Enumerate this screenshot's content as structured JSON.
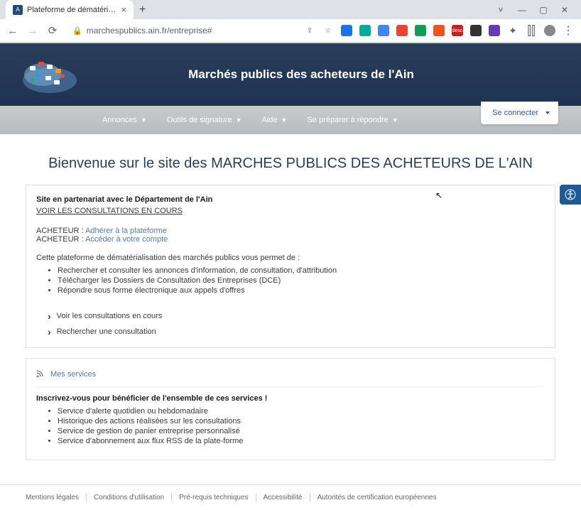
{
  "browser": {
    "tab_title": "Plateforme de dématérialisation",
    "url": "marchespublics.ain.fr/entreprise#"
  },
  "site": {
    "title": "Marchés publics des acheteurs de l'Ain"
  },
  "nav": {
    "items": [
      {
        "label": "Annonces"
      },
      {
        "label": "Outils de signature"
      },
      {
        "label": "Aide"
      },
      {
        "label": "Se préparer à répondre"
      }
    ],
    "login": "Se connecter"
  },
  "main": {
    "title": "Bienvenue sur le site des MARCHES PUBLICS DES ACHETEURS DE L'AIN",
    "panel1": {
      "partner": "Site en partenariat avec le Département de l'Ain",
      "consult_link": "VOIR LES CONSULTATIONS EN COURS",
      "buyer_label": "ACHETEUR : ",
      "buyer_join": "Adhérer à la plateforme",
      "buyer_access": "Accéder à votre compte",
      "intro": "Cette plateforme de dématérialisation des marchés publics vous permet de :",
      "bullets": [
        "Rechercher et consulter les annonces d'information, de consultation, d'attribution",
        "Télécharger les Dossiers de Consultation des Entreprises (DCE)",
        "Répondre sous forme électronique aux appels d'offres"
      ],
      "arrows": [
        "Voir les consultations en cours",
        "Rechercher une consultation"
      ]
    },
    "panel2": {
      "header": "Mes services",
      "intro": "Inscrivez-vous pour bénéficier de l'ensemble de ces services !",
      "bullets": [
        "Service d'alerte quotidien ou hebdomadaire",
        "Historique des actions réalisées sur les consultations",
        "Service de gestion de panier entreprise personnalisé",
        "Service d'abonnement aux flux RSS de la plate-forme"
      ]
    }
  },
  "footer": {
    "links": [
      "Mentions légales",
      "Conditions d'utilisation",
      "Pré-requis techniques",
      "Accessibilité",
      "Autorités de certification européennes"
    ]
  }
}
